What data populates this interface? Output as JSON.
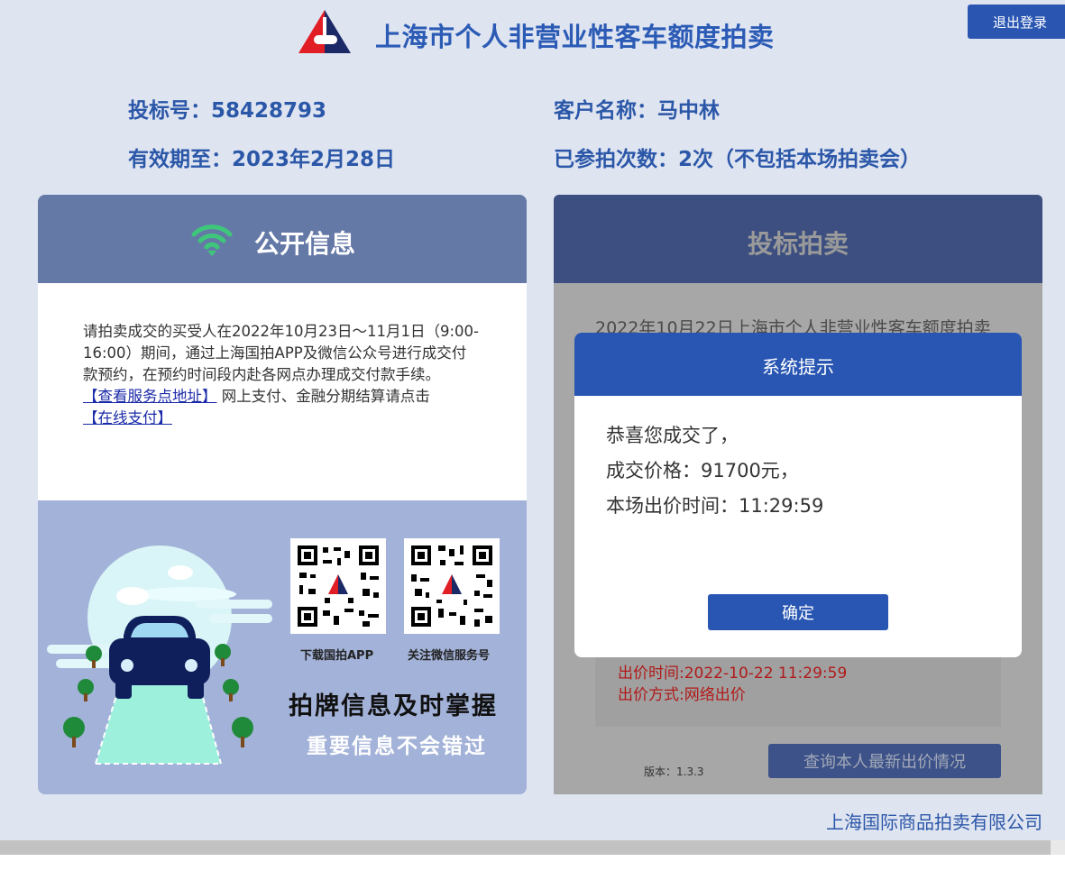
{
  "header": {
    "title": "上海市个人非营业性客车额度拍卖",
    "logout_label": "退出登录"
  },
  "bidder": {
    "bid_number": "投标号：58428793",
    "customer_name": "客户名称：马中林",
    "valid_until": "有效期至：2023年2月28日",
    "participation_count": "已参拍次数：2次（不包括本场拍卖会）"
  },
  "public_info": {
    "title": "公开信息",
    "notice": "请拍卖成交的买受人在2022年10月23日～11月1日（9:00-16:00）期间，通过上海国拍APP及微信公众号进行成交付款预约，在预约时间段内赴各网点办理成交付款手续。",
    "service_link": "【查看服务点地址】",
    "payment_text": "网上支付、金融分期结算请点击",
    "online_pay_link": "【在线支付】",
    "qr_app_caption": "下载国拍APP",
    "qr_wechat_caption": "关注微信服务号",
    "slogan_main": "拍牌信息及时掌握",
    "slogan_sub": "重要信息不会错过"
  },
  "bidding": {
    "title": "投标拍卖",
    "auction_name": "2022年10月22日上海市个人非营业性客车额度拍卖会",
    "bid_time": "出价时间:2022-10-22 11:29:59",
    "bid_method": "出价方式:网络出价",
    "version": "版本：1.3.3",
    "query_button": "查询本人最新出价情况"
  },
  "modal": {
    "title": "系统提示",
    "line1": "恭喜您成交了，",
    "line2": "成交价格：91700元，",
    "line3": "本场出价时间：11:29:59",
    "ok_label": "确定"
  },
  "footer": {
    "company": "上海国际商品拍卖有限公司"
  },
  "colors": {
    "page_bg": "#dfe4f1",
    "brand_blue": "#2856b2",
    "title_blue": "#2b5bb5",
    "panel_header": "#6579a7",
    "promo_bg": "#a3b2d8",
    "wifi_green": "#3ec77a",
    "result_red": "#b01a1a"
  },
  "icons": {
    "logo": "triangle-logo",
    "wifi": "wifi-icon",
    "qr": "qr-code"
  }
}
